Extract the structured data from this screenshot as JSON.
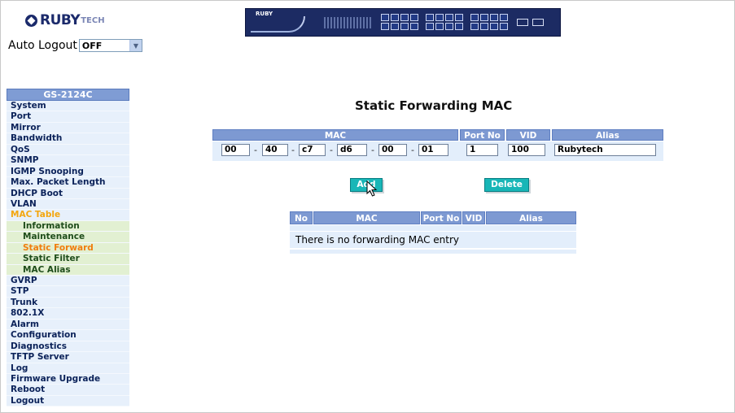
{
  "branding": {
    "logo_text": "RUBY",
    "logo_sub": "TECH",
    "banner_brand": "RUBY"
  },
  "auto_logout": {
    "label": "Auto Logout",
    "selected": "OFF"
  },
  "nav": {
    "header": "GS-2124C",
    "items": [
      {
        "label": "System"
      },
      {
        "label": "Port"
      },
      {
        "label": "Mirror"
      },
      {
        "label": "Bandwidth"
      },
      {
        "label": "QoS"
      },
      {
        "label": "SNMP"
      },
      {
        "label": "IGMP Snooping"
      },
      {
        "label": "Max. Packet Length"
      },
      {
        "label": "DHCP Boot"
      },
      {
        "label": "VLAN"
      },
      {
        "label": "MAC Table"
      },
      {
        "label": "Information"
      },
      {
        "label": "Maintenance"
      },
      {
        "label": "Static Forward"
      },
      {
        "label": "Static Filter"
      },
      {
        "label": "MAC Alias"
      },
      {
        "label": "GVRP"
      },
      {
        "label": "STP"
      },
      {
        "label": "Trunk"
      },
      {
        "label": "802.1X"
      },
      {
        "label": "Alarm"
      },
      {
        "label": "Configuration"
      },
      {
        "label": "Diagnostics"
      },
      {
        "label": "TFTP Server"
      },
      {
        "label": "Log"
      },
      {
        "label": "Firmware Upgrade"
      },
      {
        "label": "Reboot"
      },
      {
        "label": "Logout"
      }
    ]
  },
  "page": {
    "title": "Static Forwarding MAC"
  },
  "form": {
    "headers": {
      "mac": "MAC",
      "port": "Port No",
      "vid": "VID",
      "alias": "Alias"
    },
    "mac_octets": [
      "00",
      "40",
      "c7",
      "d6",
      "00",
      "01"
    ],
    "separator": "-",
    "port": "1",
    "vid": "100",
    "alias": "Rubytech"
  },
  "buttons": {
    "add": "Add",
    "delete": "Delete"
  },
  "table": {
    "headers": {
      "no": "No",
      "mac": "MAC",
      "port": "Port No",
      "vid": "VID",
      "alias": "Alias"
    },
    "empty_message": "There is no forwarding MAC entry"
  }
}
